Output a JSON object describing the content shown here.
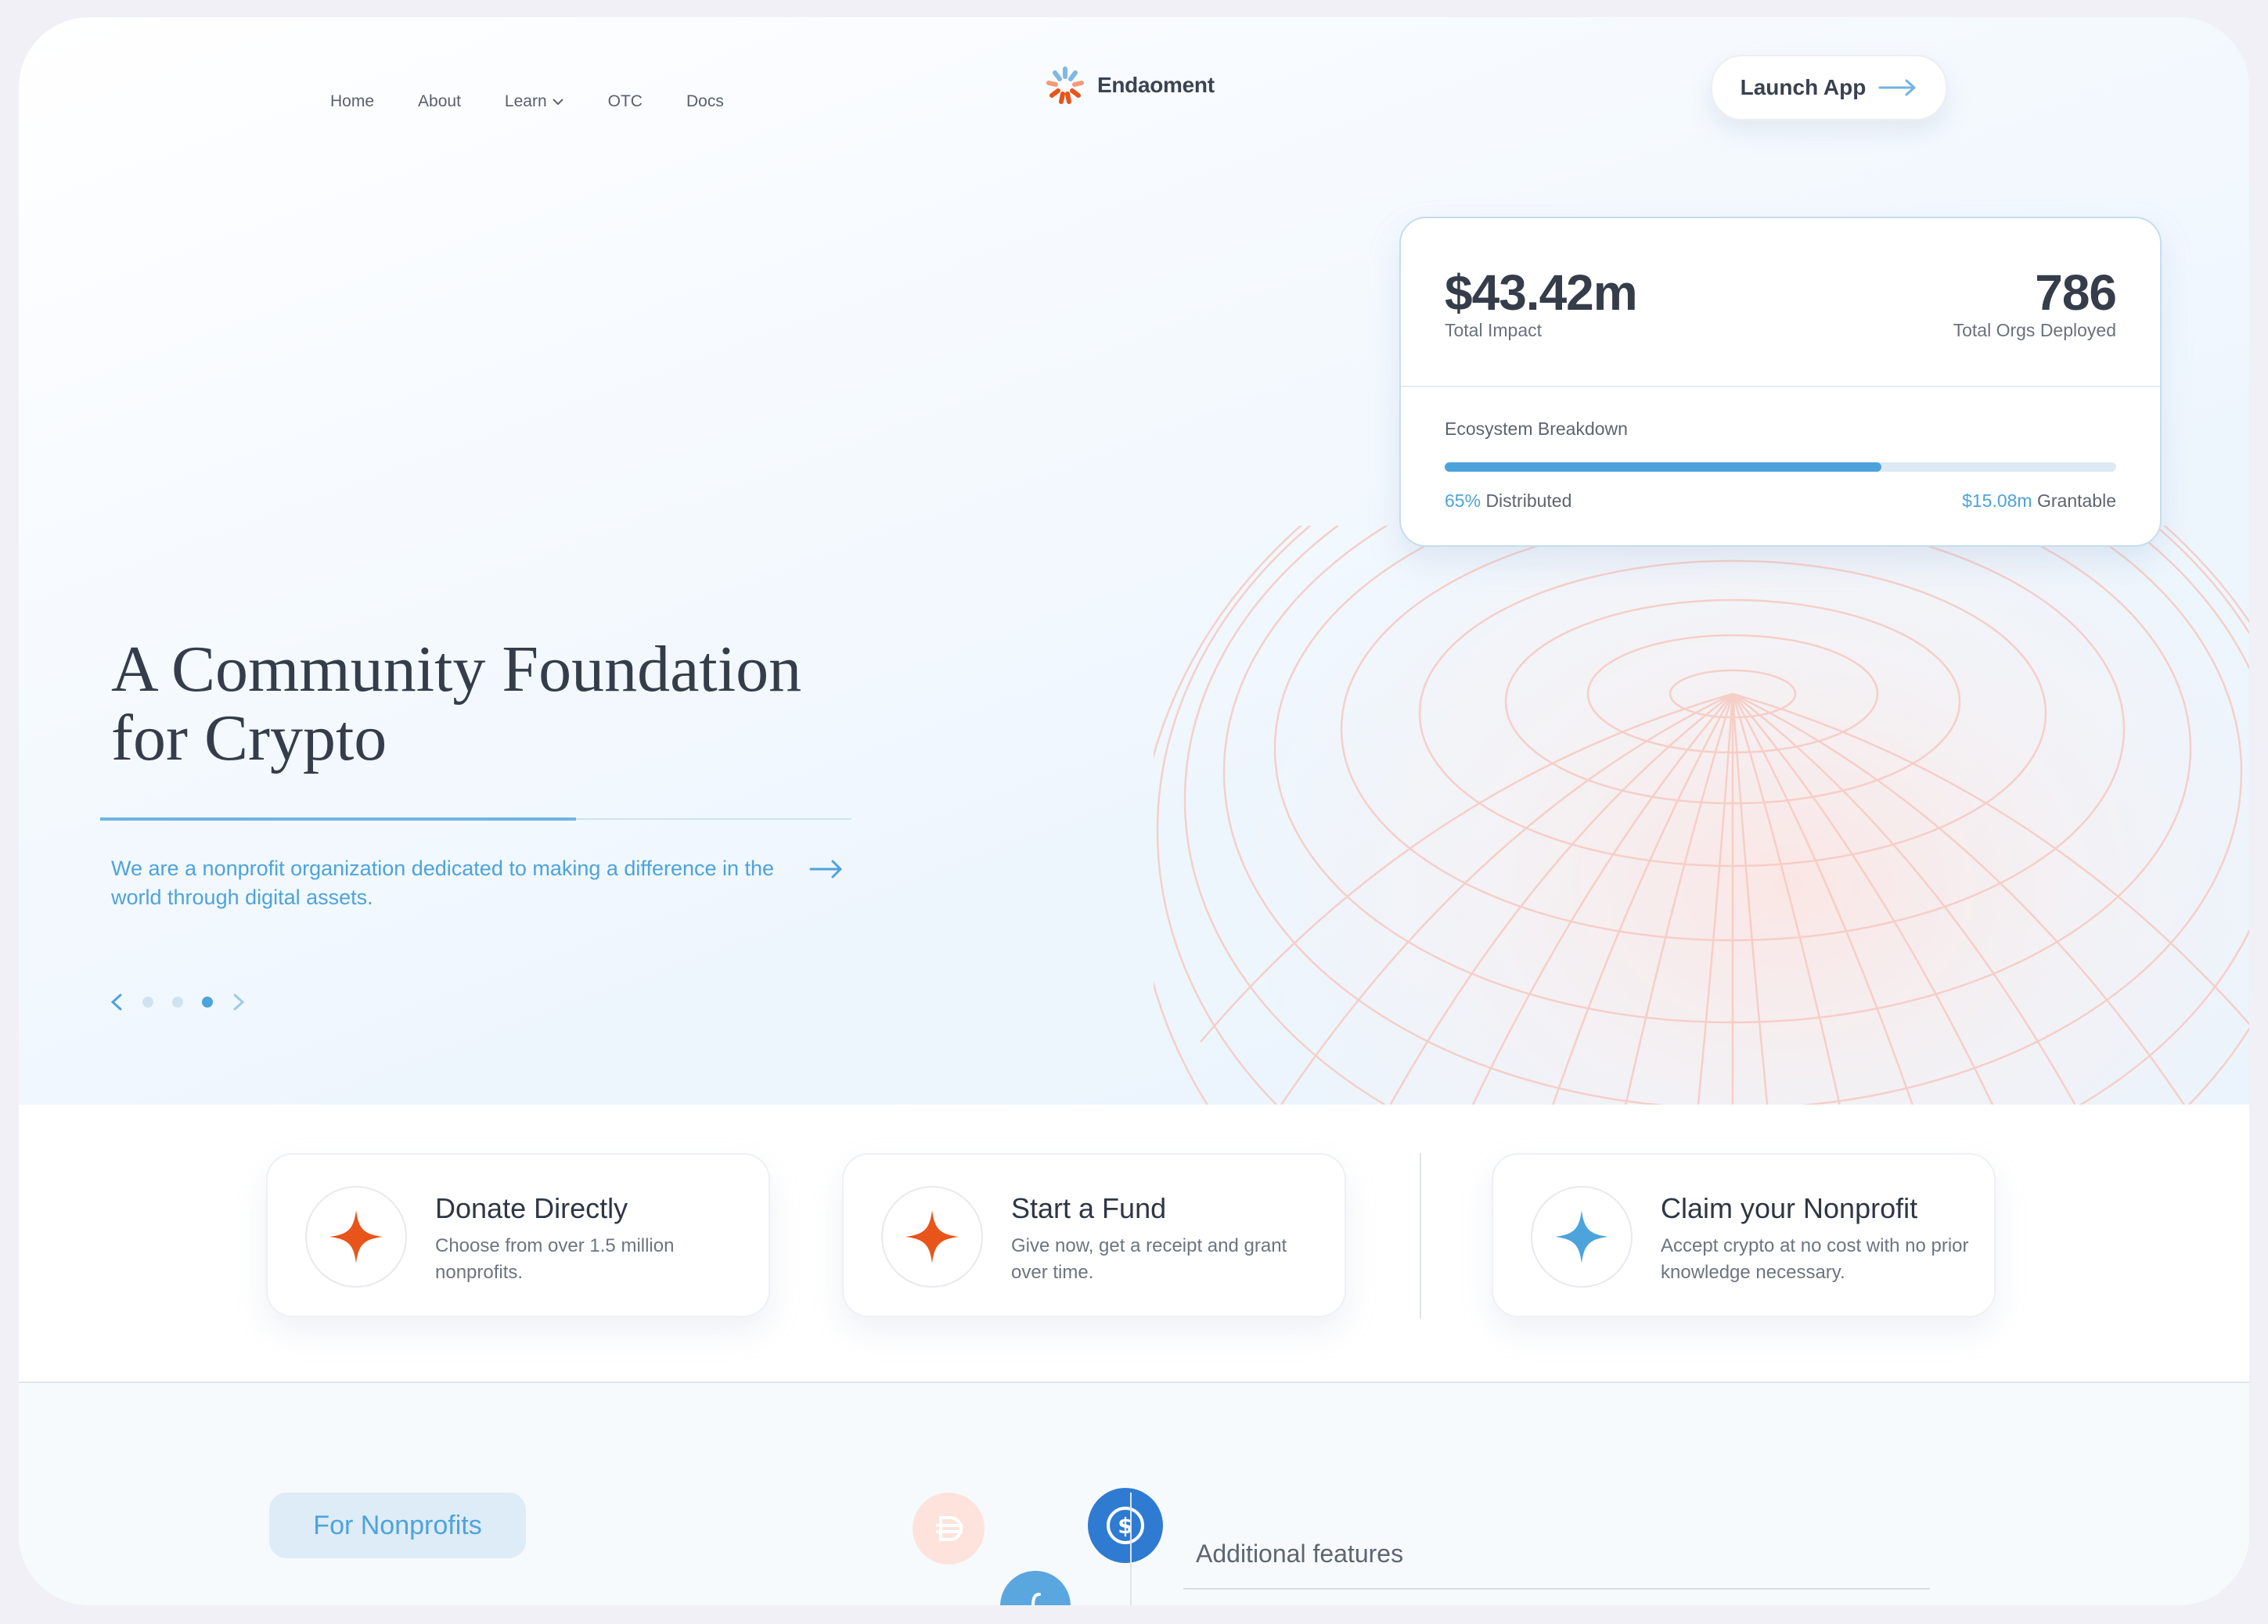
{
  "nav": {
    "items": [
      "Home",
      "About",
      "Learn",
      "OTC",
      "Docs"
    ]
  },
  "brand": {
    "name": "Endaoment"
  },
  "header": {
    "launch_label": "Launch App"
  },
  "stats": {
    "total_impact_value": "$43.42m",
    "total_impact_label": "Total Impact",
    "orgs_value": "786",
    "orgs_label": "Total Orgs Deployed",
    "breakdown_title": "Ecosystem Breakdown",
    "distributed_percent": "65%",
    "distributed_label": "Distributed",
    "distributed_fraction": 0.65,
    "grantable_value": "$15.08m",
    "grantable_label": "Grantable"
  },
  "hero": {
    "headline_line1": "A Community Foundation",
    "headline_line2": "for Crypto",
    "tagline": "We are a nonprofit organization dedicated to making a difference in the world through digital assets.",
    "carousel_active": 3,
    "carousel_count": 3
  },
  "features": [
    {
      "title": "Donate Directly",
      "desc": "Choose from over 1.5 million nonprofits.",
      "icon": "sparkle-orange-icon"
    },
    {
      "title": "Start a Fund",
      "desc": "Give now, get a receipt and grant over time.",
      "icon": "sparkle-orange-icon"
    },
    {
      "title": "Claim your Nonprofit",
      "desc": "Accept crypto at no cost with no prior knowledge necessary.",
      "icon": "sparkle-blue-icon"
    }
  ],
  "lower": {
    "pill_label": "For Nonprofits",
    "additional_title": "Additional features"
  },
  "colors": {
    "accent": "#4da3dc",
    "sparkle_orange": "#e8541a",
    "sparkle_blue": "#4da3dc",
    "text": "#353d4b"
  }
}
